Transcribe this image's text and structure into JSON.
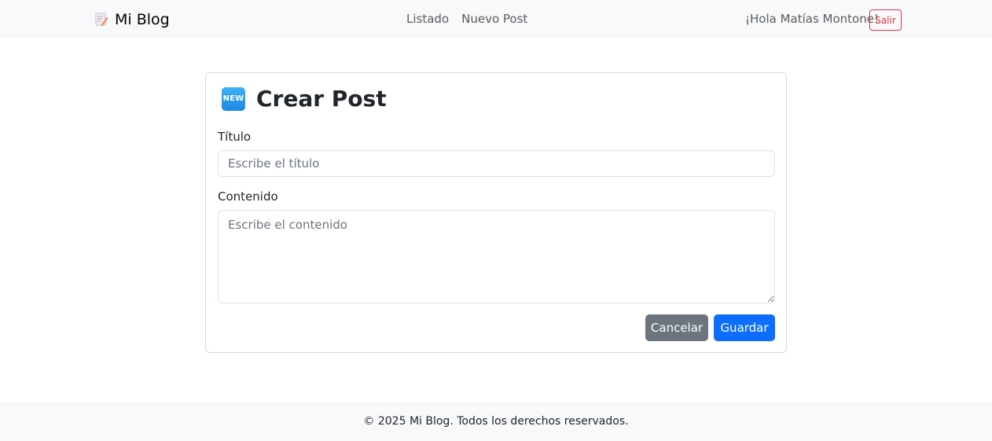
{
  "navbar": {
    "brand": "Mi Blog",
    "brand_icon": "memo-icon",
    "links": [
      "Listado",
      "Nuevo Post"
    ],
    "greeting": "¡Hola Matías Montone!",
    "logout_label": "Salir"
  },
  "form": {
    "badge": "NEW",
    "title": "Crear Post",
    "title_label": "Título",
    "title_placeholder": "Escribe el título",
    "content_label": "Contenido",
    "content_placeholder": "Escribe el contenido",
    "cancel_label": "Cancelar",
    "save_label": "Guardar"
  },
  "footer": {
    "text": "© 2025 Mi Blog. Todos los derechos reservados."
  },
  "colors": {
    "primary": "#0d6efd",
    "secondary": "#6c757d",
    "danger": "#dc3545",
    "navbar_bg": "#f8f9fa"
  }
}
